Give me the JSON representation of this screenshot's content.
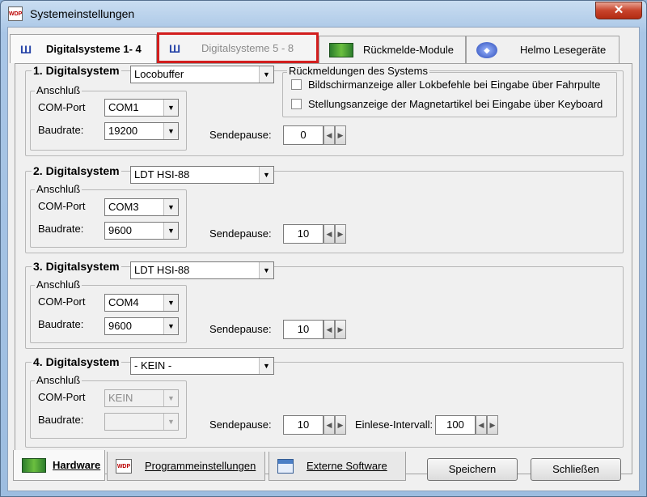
{
  "window": {
    "app_icon_text": "WDP",
    "title": "Systemeinstellungen",
    "close_glyph": "✕"
  },
  "top_tabs": [
    {
      "label": "Digitalsysteme 1- 4",
      "icon": "digital-system-icon",
      "active": true
    },
    {
      "label": "Digitalsysteme 5 - 8",
      "icon": "digital-system-icon",
      "highlighted": true
    },
    {
      "label": "Rückmelde-Module",
      "icon": "circuit-board-icon"
    },
    {
      "label": "Helmo Lesegeräte",
      "icon": "helmo-reader-icon"
    }
  ],
  "labels": {
    "anschluss": "Anschluß",
    "com_port": "COM-Port",
    "baudrate": "Baudrate:",
    "sendepause": "Sendepause:",
    "einlese_intervall": "Einlese-Intervall:"
  },
  "systems": [
    {
      "title": "1. Digitalsystem",
      "type": "Locobuffer",
      "com_port": "COM1",
      "baudrate": "19200",
      "sendepause": "0"
    },
    {
      "title": "2. Digitalsystem",
      "type": "LDT HSI-88",
      "com_port": "COM3",
      "baudrate": "9600",
      "sendepause": "10"
    },
    {
      "title": "3. Digitalsystem",
      "type": "LDT HSI-88",
      "com_port": "COM4",
      "baudrate": "9600",
      "sendepause": "10"
    },
    {
      "title": "4. Digitalsystem",
      "type": "- KEIN -",
      "com_port": "KEIN",
      "baudrate": "",
      "sendepause": "10",
      "einlese_intervall": "100"
    }
  ],
  "rueckmeldungen": {
    "title": "Rückmeldungen des Systems",
    "options": [
      {
        "label": "Bildschirmanzeige aller Lokbefehle bei Eingabe über Fahrpulte",
        "checked": false
      },
      {
        "label": "Stellungsanzeige der Magnetartikel bei Eingabe über Keyboard",
        "checked": false
      }
    ]
  },
  "bottom_tabs": [
    {
      "label": "Hardware",
      "icon": "circuit-board-icon",
      "active": true
    },
    {
      "label": "Programmeinstellungen",
      "icon": "wdp-icon"
    },
    {
      "label": "Externe Software",
      "icon": "window-icon"
    }
  ],
  "buttons": {
    "save": "Speichern",
    "close": "Schließen"
  }
}
